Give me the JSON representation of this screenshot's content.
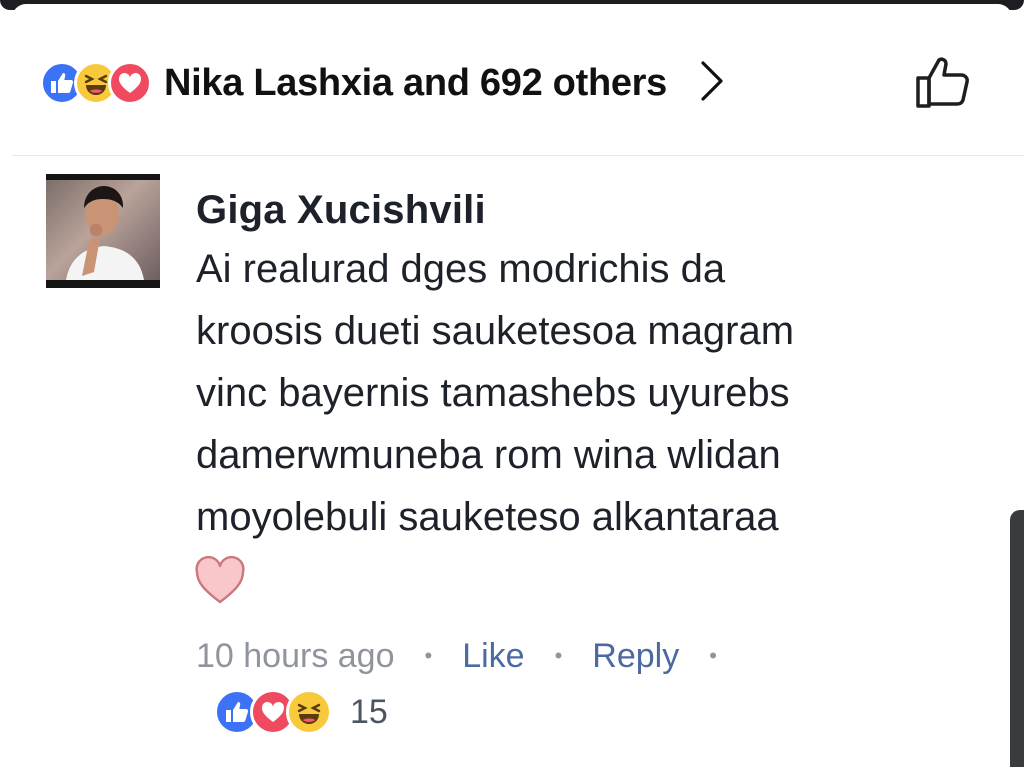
{
  "post": {
    "reactions_summary": {
      "icons": [
        "like-icon",
        "haha-icon",
        "love-icon"
      ],
      "text": "Nika Lashxia and 692 others"
    }
  },
  "comment": {
    "author": "Giga Xucishvili",
    "text": "Ai realurad dges modrichis da\nkroosis dueti sauketesoa magram\nvinc bayernis tamashebs uyurebs\ndamerwmuneba rom wina wlidan\nmoyolebuli sauketeso alkantaraa",
    "emoji": "heart-emoji",
    "timestamp": "10 hours ago",
    "like_label": "Like",
    "reply_label": "Reply",
    "reactions": {
      "icons": [
        "like-icon",
        "love-icon",
        "haha-icon"
      ],
      "count": "15"
    }
  },
  "colors": {
    "like_blue": "#3b72f6",
    "love_red": "#ef4a5f",
    "haha_yellow": "#f7c93b",
    "link": "#4b6aa0",
    "meta_gray": "#90949c"
  }
}
